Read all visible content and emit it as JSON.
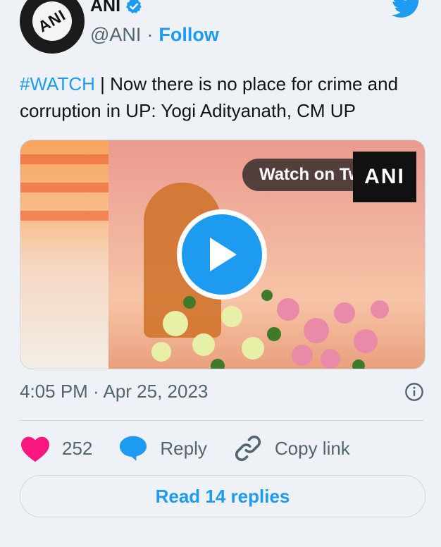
{
  "author": {
    "name": "ANI",
    "handle": "@ANI",
    "separator": "·",
    "follow_label": "Follow",
    "avatar_text": "ANI"
  },
  "tweet": {
    "hashtag": "#WATCH",
    "text": " | Now there is no place for crime and corruption in UP: Yogi Adityanath, CM UP"
  },
  "media": {
    "watch_label": "Watch on Twitter",
    "overlay_logo": "ANI"
  },
  "meta": {
    "timestamp": "4:05 PM · Apr 25, 2023"
  },
  "actions": {
    "like_count": "252",
    "reply_label": "Reply",
    "copy_label": "Copy link"
  },
  "read_replies_label": "Read 14 replies",
  "colors": {
    "accent": "#1d9bf0",
    "like": "#f91880",
    "text_secondary": "#536471"
  },
  "icons": [
    "verified-icon",
    "twitter-bird-icon",
    "play-icon",
    "info-icon",
    "heart-icon",
    "reply-bubble-icon",
    "link-icon"
  ]
}
